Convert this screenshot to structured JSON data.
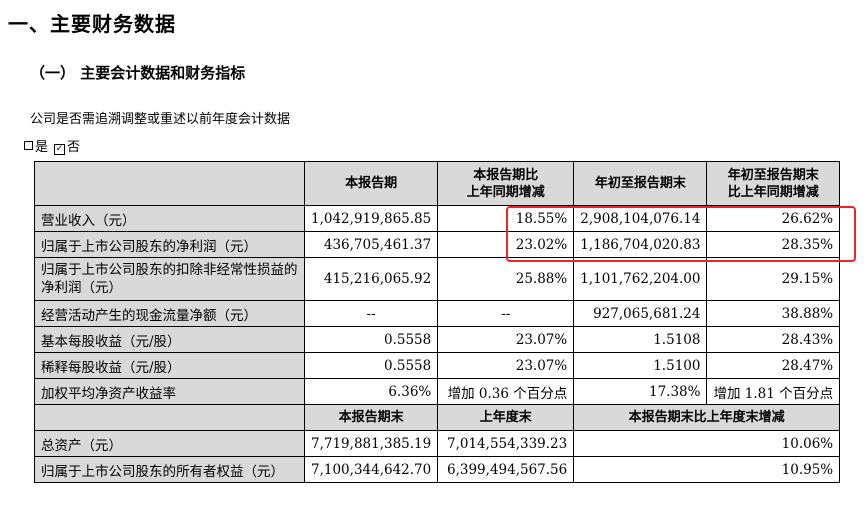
{
  "section_title": "一、主要财务数据",
  "subsection_title": "（一） 主要会计数据和财务指标",
  "question": "公司是否需追溯调整或重述以前年度会计数据",
  "answer": {
    "yes": "是",
    "no": "否",
    "checked": "no",
    "check_mark": "☑"
  },
  "table": {
    "header": [
      "",
      "本报告期",
      "本报告期比\n上年同期增减",
      "年初至报告期末",
      "年初至报告期末\n比上年同期增减"
    ],
    "rows": [
      {
        "label": "营业收入（元）",
        "values": [
          "1,042,919,865.85",
          "18.55%",
          "2,908,104,076.14",
          "26.62%"
        ]
      },
      {
        "label": "归属于上市公司股东的净利润（元）",
        "values": [
          "436,705,461.37",
          "23.02%",
          "1,186,704,020.83",
          "28.35%"
        ]
      },
      {
        "label": "归属于上市公司股东的扣除非经常性损益的净利润（元）",
        "values": [
          "415,216,065.92",
          "25.88%",
          "1,101,762,204.00",
          "29.15%"
        ]
      },
      {
        "label": "经营活动产生的现金流量净额（元）",
        "values": [
          "--",
          "--",
          "927,065,681.24",
          "38.88%"
        ]
      },
      {
        "label": "基本每股收益（元/股）",
        "values": [
          "0.5558",
          "23.07%",
          "1.5108",
          "28.43%"
        ]
      },
      {
        "label": "稀释每股收益（元/股）",
        "values": [
          "0.5558",
          "23.07%",
          "1.5100",
          "28.47%"
        ]
      },
      {
        "label": "加权平均净资产收益率",
        "values": [
          "6.36%",
          "增加 0.36 个百分点",
          "17.38%",
          "增加 1.81 个百分点"
        ]
      }
    ],
    "header2": [
      "",
      "本报告期末",
      "上年度末",
      "本报告期末比上年度末增减"
    ],
    "rows2": [
      {
        "label": "总资产（元）",
        "values": [
          "7,719,881,385.19",
          "7,014,554,339.23",
          "10.06%"
        ]
      },
      {
        "label": "归属于上市公司股东的所有者权益（元）",
        "values": [
          "7,100,344,642.70",
          "6,399,494,567.56",
          "10.95%"
        ]
      }
    ]
  },
  "highlight_color": "#e8262b"
}
